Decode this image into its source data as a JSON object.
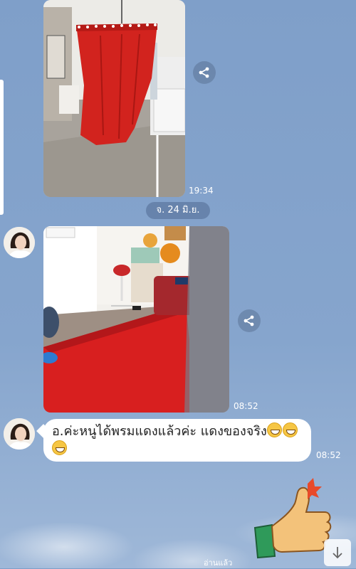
{
  "chat": {
    "messages": [
      {
        "type": "image",
        "description_hidden": "",
        "time": "19:34"
      },
      {
        "type": "date",
        "label": "จ. 24 มิ.ย."
      },
      {
        "type": "image",
        "time": "08:52"
      },
      {
        "type": "text",
        "text": "อ.ค่ะหนูได้พรมแดงแล้วค่ะ   แดงของจริง",
        "time": "08:52"
      },
      {
        "type": "sticker",
        "read_status": "อ่านแล้ว"
      }
    ]
  },
  "icons": {
    "share": "share-icon",
    "scroll_down": "arrow-down-icon",
    "sticker": "thumbs-up-sticker"
  },
  "colors": {
    "background": "#86a5cd",
    "bubble": "#ffffff",
    "carpet_red": "#d81f1f"
  }
}
